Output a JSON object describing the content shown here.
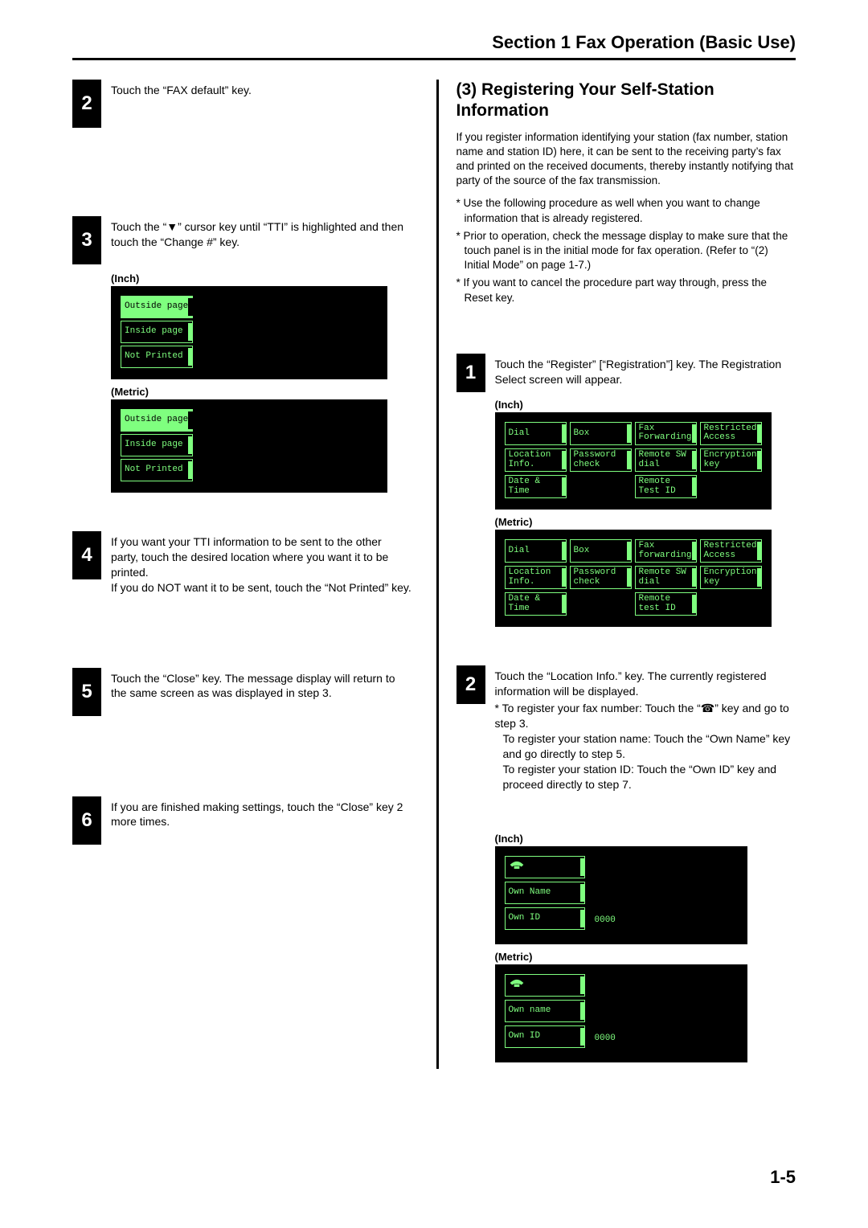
{
  "header": {
    "section_title": "Section 1  Fax Operation (Basic Use)"
  },
  "page_number": "1-5",
  "left": {
    "step2": {
      "num": "2",
      "text": "Touch the “FAX default” key."
    },
    "step3": {
      "num": "3",
      "text": "Touch the “▼” cursor key until “TTI” is highlighted and then touch the “Change #” key.",
      "inch_label": "(Inch)",
      "metric_label": "(Metric)",
      "options": {
        "outside": "Outside page",
        "inside": "Inside page",
        "not_printed_inch": "Not Printed",
        "not_printed_metric": "Not Printed"
      }
    },
    "step4": {
      "num": "4",
      "text": "If you want your TTI information to be sent to the other party, touch the desired location where you want it to be printed.\nIf you do NOT want it to be sent, touch the “Not Printed” key."
    },
    "step5": {
      "num": "5",
      "text": "Touch the “Close” key. The message display will return to the same screen as was displayed in step 3."
    },
    "step6": {
      "num": "6",
      "text": "If you are finished making settings, touch the “Close” key 2 more times."
    }
  },
  "right": {
    "heading": "(3) Registering Your Self-Station Information",
    "intro": "If you register information identifying your station (fax number, station name and station ID) here, it can be sent to the receiving party’s fax and printed on the received documents, thereby instantly notifying that party of the source of the fax transmission.",
    "bullets": [
      "* Use the following procedure as well when you want to change information that is already registered.",
      "* Prior to operation, check the message display to make sure that the touch panel is in the initial mode for fax operation. (Refer to “(2) Initial Mode” on page 1-7.)",
      "* If you want to cancel the procedure part way through, press the Reset key."
    ],
    "step1": {
      "num": "1",
      "text": "Touch the “Register” [“Registration”] key. The Registration Select screen will appear.",
      "inch_label": "(Inch)",
      "metric_label": "(Metric)",
      "inch_btns": [
        "Dial",
        "Box",
        "Fax Forwarding",
        "Restricted Access",
        "Location Info.",
        "Password check",
        "Remote SW dial",
        "Encryption key",
        "Date & Time",
        "",
        "Remote Test ID",
        ""
      ],
      "metric_btns": [
        "Dial",
        "Box",
        "Fax forwarding",
        "Restricted Access",
        "Location Info.",
        "Password check",
        "Remote SW dial",
        "Encryption key",
        "Date & Time",
        "",
        "Remote test ID",
        ""
      ]
    },
    "step2": {
      "num": "2",
      "text": "Touch the “Location Info.” key. The currently registered information will be displayed.",
      "sub1": "* To register your fax number: Touch the “☎” key and go to step 3.",
      "sub2": "To register your station name: Touch the “Own Name” key and go directly to step 5.",
      "sub3": "To register your station ID: Touch the “Own ID” key and proceed directly to step 7.",
      "inch_label": "(Inch)",
      "metric_label": "(Metric)",
      "inch_own": {
        "phone": "☎",
        "own_name": "Own Name",
        "own_id": "Own ID",
        "own_id_val": "0000"
      },
      "metric_own": {
        "phone": "☎",
        "own_name": "Own name",
        "own_id": "Own ID",
        "own_id_val": "0000"
      }
    }
  }
}
